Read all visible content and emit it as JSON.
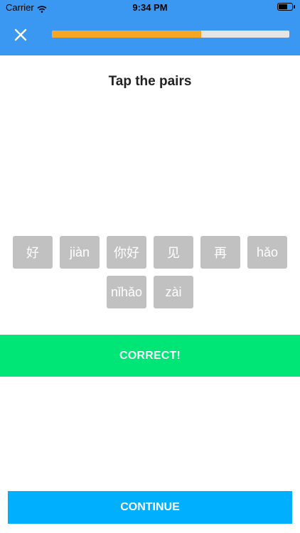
{
  "status": {
    "carrier": "Carrier",
    "time": "9:34 PM"
  },
  "header": {
    "close_icon": "close-icon",
    "progress": 0.63
  },
  "title": "Tap the pairs",
  "tiles": {
    "row1": [
      "好",
      "jiàn",
      "你好",
      "见",
      "再",
      "hǎo"
    ],
    "row2": [
      "nǐhǎo",
      "zài"
    ]
  },
  "banner": {
    "text": "CORRECT!"
  },
  "continue_label": "CONTINUE",
  "colors": {
    "header": "#3a98f2",
    "progress_fill": "#f5a623",
    "banner": "#00e676",
    "continue": "#00b0ff",
    "tile": "#c1c1c1"
  }
}
